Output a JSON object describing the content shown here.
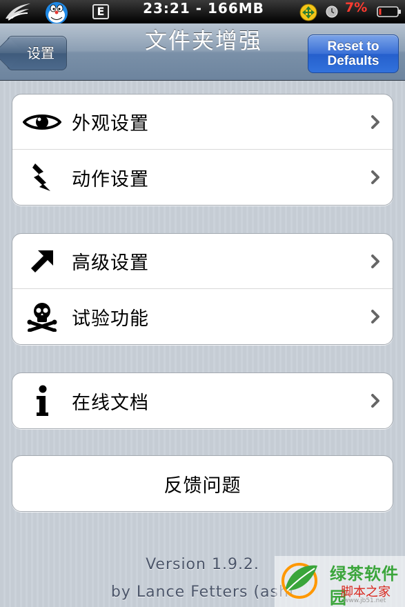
{
  "status_bar": {
    "carrier_badge": "E",
    "time_memory": "23:21 - 166MB",
    "battery_percent": "7%"
  },
  "nav": {
    "back_label": "设置",
    "title": "文件夹增强",
    "reset_line1": "Reset to",
    "reset_line2": "Defaults"
  },
  "groups": [
    {
      "rows": [
        {
          "label": "外观设置",
          "icon": "eye-icon"
        },
        {
          "label": "动作设置",
          "icon": "lightning-icon"
        }
      ]
    },
    {
      "rows": [
        {
          "label": "高级设置",
          "icon": "arrow-up-right-icon"
        },
        {
          "label": "试验功能",
          "icon": "skull-crossbones-icon"
        }
      ]
    },
    {
      "rows": [
        {
          "label": "在线文档",
          "icon": "info-icon"
        }
      ]
    },
    {
      "rows": [
        {
          "label": "反馈问题"
        }
      ]
    }
  ],
  "footer": {
    "version": "Version 1.9.2.",
    "author": "by Lance Fetters (ashi"
  },
  "watermark": {
    "site_name": "绿茶软件园",
    "brand": "脚本之家",
    "domain": "www.jb51.net"
  },
  "colors": {
    "background": "#c5ccd4",
    "nav_bar": "#7a90a8",
    "reset_button": "#2f6bd8",
    "battery_text": "#ff3b30"
  }
}
